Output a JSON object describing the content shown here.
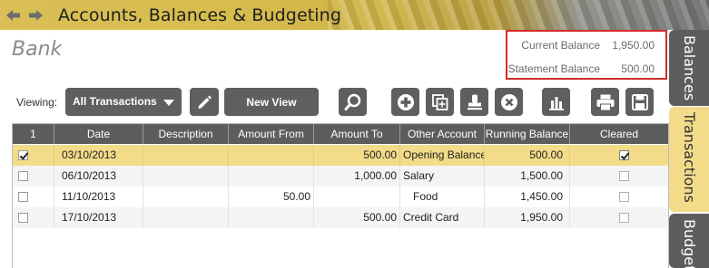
{
  "window": {
    "title": "Accounts, Balances & Budgeting"
  },
  "page": {
    "heading": "Bank"
  },
  "balances": {
    "current_label": "Current Balance",
    "current_value": "1,950.00",
    "statement_label": "Statement Balance",
    "statement_value": "500.00"
  },
  "side_tabs": [
    {
      "label": "Balances",
      "active": false
    },
    {
      "label": "Transactions",
      "active": true
    },
    {
      "label": "Budgets",
      "active": false
    }
  ],
  "toolbar": {
    "viewing_label": "Viewing:",
    "view_selected": "All Transactions",
    "new_view_label": "New View",
    "icons": [
      "edit-icon",
      "search-icon",
      "add-icon",
      "copy-icon",
      "stamp-icon",
      "delete-icon",
      "chart-icon",
      "print-icon",
      "save-icon"
    ]
  },
  "table": {
    "columns": [
      "1",
      "Date",
      "Description",
      "Amount From",
      "Amount To",
      "Other Account",
      "Running Balance",
      "Cleared"
    ],
    "rows": [
      {
        "selected": true,
        "checked": true,
        "date": "03/10/2013",
        "description": "",
        "amount_from": "",
        "amount_to": "500.00",
        "other_account": "Opening Balance",
        "running_balance": "500.00",
        "cleared": true
      },
      {
        "selected": false,
        "checked": false,
        "date": "06/10/2013",
        "description": "",
        "amount_from": "",
        "amount_to": "1,000.00",
        "other_account": "Salary",
        "running_balance": "1,500.00",
        "cleared": false
      },
      {
        "selected": false,
        "checked": false,
        "date": "11/10/2013",
        "description": "",
        "amount_from": "50.00",
        "amount_to": "",
        "other_account": "Food",
        "running_balance": "1,450.00",
        "cleared": false
      },
      {
        "selected": false,
        "checked": false,
        "date": "17/10/2013",
        "description": "",
        "amount_from": "",
        "amount_to": "500.00",
        "other_account": "Credit Card",
        "running_balance": "1,950.00",
        "cleared": false
      }
    ]
  },
  "colors": {
    "accent_gold": "#f2dc8a",
    "toolbar_gray": "#5f5f5f",
    "highlight_red": "#d42a2a"
  }
}
